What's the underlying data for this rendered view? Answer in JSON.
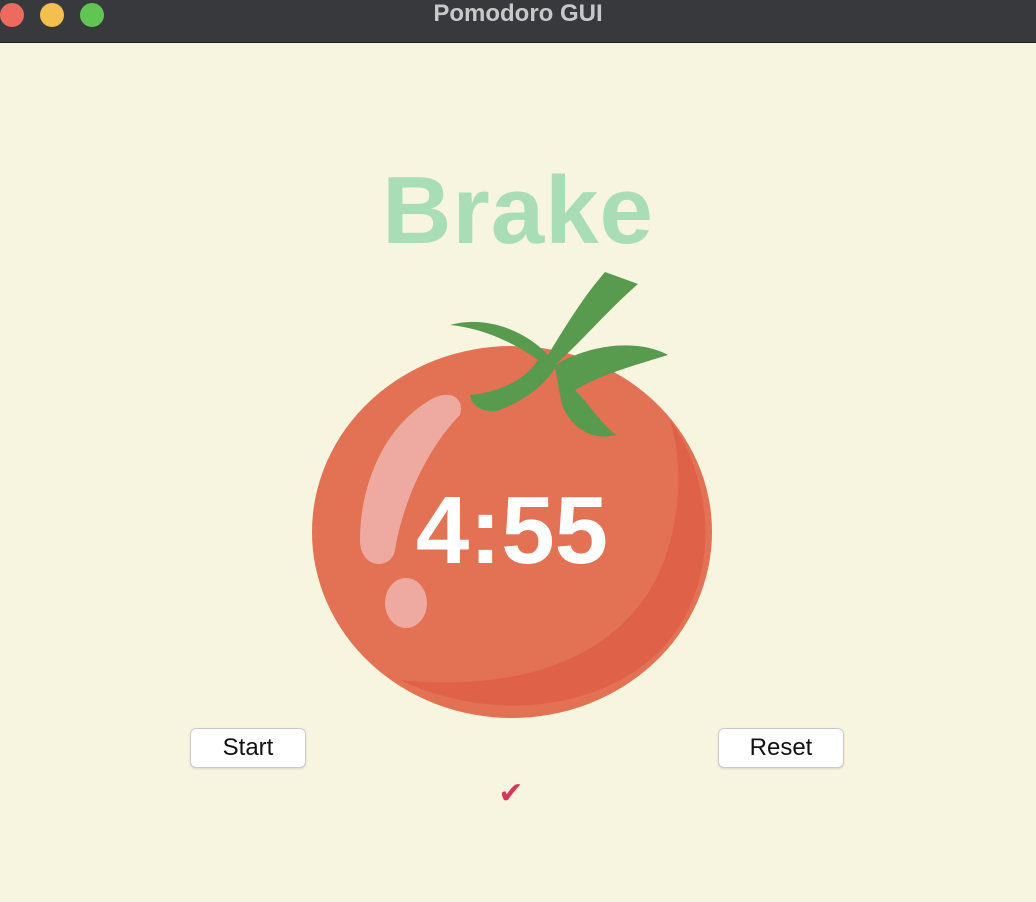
{
  "window": {
    "title": "Pomodoro GUI"
  },
  "timer": {
    "mode_label": "Brake",
    "time": "4:55"
  },
  "controls": {
    "start_label": "Start",
    "reset_label": "Reset"
  },
  "progress": {
    "checkmarks": "✔"
  },
  "colors": {
    "background": "#f7f5e0",
    "mode_label": "#a8ddb5",
    "checkmark": "#d6375c",
    "tomato": "#e27253",
    "leaves": "#589b4f"
  },
  "icons": {
    "tomato": "tomato-image",
    "window_close": "close-traffic-light",
    "window_minimize": "minimize-traffic-light",
    "window_maximize": "maximize-traffic-light"
  }
}
